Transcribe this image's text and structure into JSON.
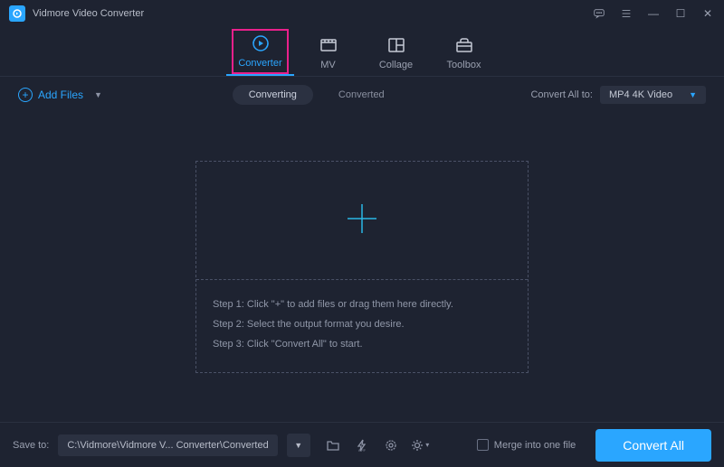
{
  "titlebar": {
    "title": "Vidmore Video Converter"
  },
  "nav": {
    "items": [
      {
        "label": "Converter",
        "active": true
      },
      {
        "label": "MV"
      },
      {
        "label": "Collage"
      },
      {
        "label": "Toolbox"
      }
    ]
  },
  "subbar": {
    "add_files_label": "Add Files",
    "converting_label": "Converting",
    "converted_label": "Converted",
    "convert_all_to_label": "Convert All to:",
    "format_selected": "MP4 4K Video"
  },
  "dropzone": {
    "step1": "Step 1: Click \"+\" to add files or drag them here directly.",
    "step2": "Step 2: Select the output format you desire.",
    "step3": "Step 3: Click \"Convert All\" to start."
  },
  "bottombar": {
    "saveto_label": "Save to:",
    "path": "C:\\Vidmore\\Vidmore V... Converter\\Converted",
    "merge_label": "Merge into one file",
    "convert_all_label": "Convert All"
  }
}
